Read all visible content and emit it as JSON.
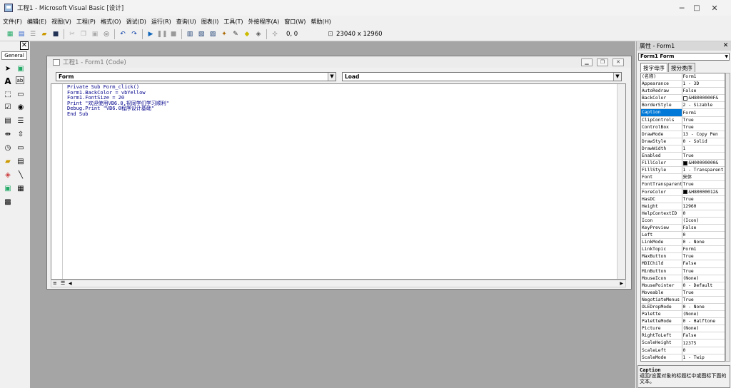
{
  "window": {
    "title": "工程1 - Microsoft Visual Basic [设计]",
    "minimize": "─",
    "maximize": "□",
    "close": "✕"
  },
  "menu": [
    "文件(F)",
    "编辑(E)",
    "视图(V)",
    "工程(P)",
    "格式(O)",
    "调试(D)",
    "运行(R)",
    "查询(U)",
    "图表(I)",
    "工具(T)",
    "外接程序(A)",
    "窗口(W)",
    "帮助(H)"
  ],
  "toolbar": {
    "position": "0, 0",
    "size": "23040 x 12960"
  },
  "toolbox": {
    "tab": "General",
    "close": "✕"
  },
  "code_window": {
    "title": "工程1 - Form1 (Code)",
    "object_combo": "Form",
    "proc_combo": "Load",
    "lines": [
      "Private Sub Form_click()",
      "Form1.BackColor = vbYellow",
      "Form1.FontSize = 20",
      "Print \"欢迎使用VB6.0,祝同学们学习顺利\"",
      "Debug.Print \"VB6.0程序设计基础\"",
      "End Sub"
    ]
  },
  "properties": {
    "title": "属性 - Form1",
    "close": "✕",
    "object": "Form1  Form",
    "tabs": [
      "按字母序",
      "按分类序"
    ],
    "rows": [
      {
        "name": "(名称)",
        "value": "Form1"
      },
      {
        "name": "Appearance",
        "value": "1 - 3D"
      },
      {
        "name": "AutoRedraw",
        "value": "False"
      },
      {
        "name": "BackColor",
        "value": "&H8000000F&",
        "swatch": "#ffffff"
      },
      {
        "name": "BorderStyle",
        "value": "2 - Sizable"
      },
      {
        "name": "Caption",
        "value": "Form1",
        "selected": true
      },
      {
        "name": "ClipControls",
        "value": "True"
      },
      {
        "name": "ControlBox",
        "value": "True"
      },
      {
        "name": "DrawMode",
        "value": "13 - Copy Pen"
      },
      {
        "name": "DrawStyle",
        "value": "0 - Solid"
      },
      {
        "name": "DrawWidth",
        "value": "1"
      },
      {
        "name": "Enabled",
        "value": "True"
      },
      {
        "name": "FillColor",
        "value": "&H00000000&",
        "swatch": "#000000"
      },
      {
        "name": "FillStyle",
        "value": "1 - Transparent"
      },
      {
        "name": "Font",
        "value": "宋体"
      },
      {
        "name": "FontTransparent",
        "value": "True"
      },
      {
        "name": "ForeColor",
        "value": "&H80000012&",
        "swatch": "#000000"
      },
      {
        "name": "HasDC",
        "value": "True"
      },
      {
        "name": "Height",
        "value": "12960"
      },
      {
        "name": "HelpContextID",
        "value": "0"
      },
      {
        "name": "Icon",
        "value": "(Icon)"
      },
      {
        "name": "KeyPreview",
        "value": "False"
      },
      {
        "name": "Left",
        "value": "0"
      },
      {
        "name": "LinkMode",
        "value": "0 - None"
      },
      {
        "name": "LinkTopic",
        "value": "Form1"
      },
      {
        "name": "MaxButton",
        "value": "True"
      },
      {
        "name": "MDIChild",
        "value": "False"
      },
      {
        "name": "MinButton",
        "value": "True"
      },
      {
        "name": "MouseIcon",
        "value": "(None)"
      },
      {
        "name": "MousePointer",
        "value": "0 - Default"
      },
      {
        "name": "Moveable",
        "value": "True"
      },
      {
        "name": "NegotiateMenus",
        "value": "True"
      },
      {
        "name": "OLEDropMode",
        "value": "0 - None"
      },
      {
        "name": "Palette",
        "value": "(None)"
      },
      {
        "name": "PaletteMode",
        "value": "0 - Halftone"
      },
      {
        "name": "Picture",
        "value": "(None)"
      },
      {
        "name": "RightToLeft",
        "value": "False"
      },
      {
        "name": "ScaleHeight",
        "value": "12375"
      },
      {
        "name": "ScaleLeft",
        "value": "0"
      },
      {
        "name": "ScaleMode",
        "value": "1 - Twip"
      }
    ],
    "desc_title": "Caption",
    "desc_text": "返回/设置对象的标题栏中或图标下面的文本。"
  }
}
